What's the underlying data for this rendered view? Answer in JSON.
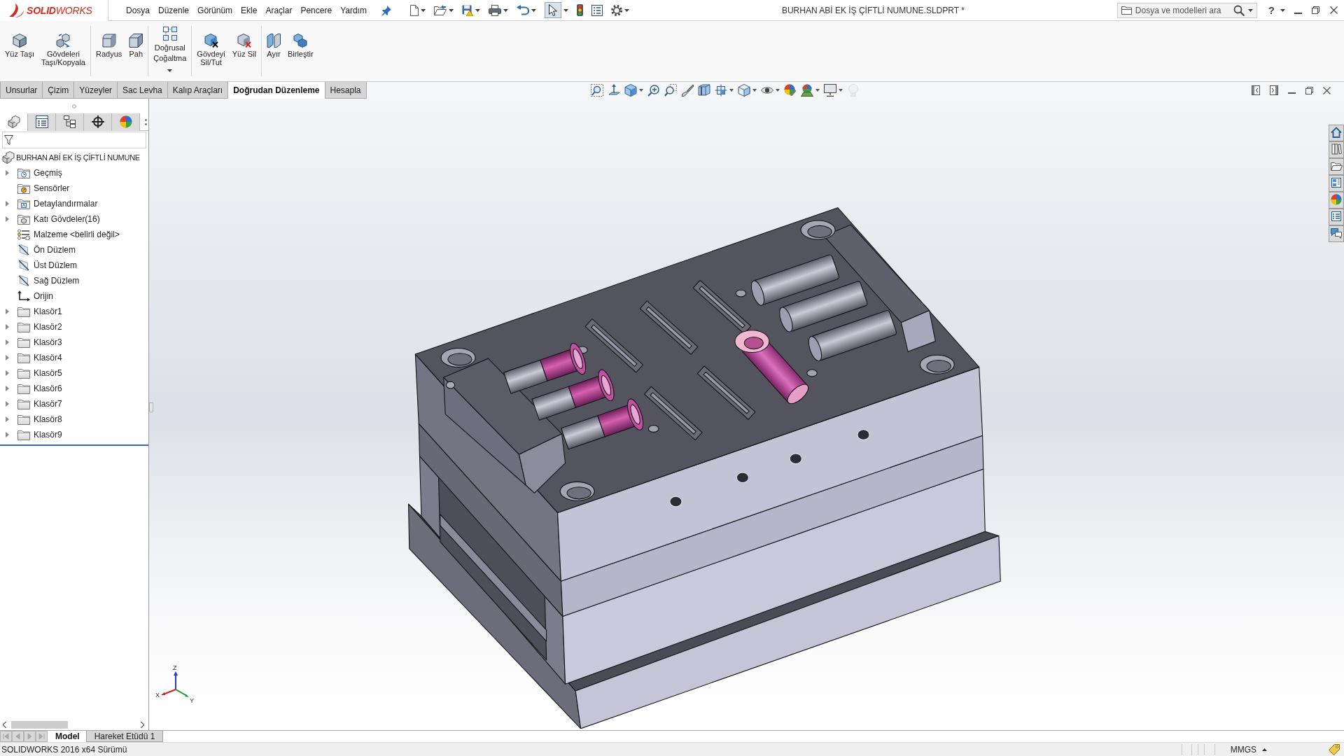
{
  "title_bar": {
    "logo": "**SOLID**WORKS",
    "menu": [
      "Dosya",
      "Düzenle",
      "Görünüm",
      "Ekle",
      "Araçlar",
      "Pencere",
      "Yardım"
    ],
    "toolbar": [
      {
        "dropdown": true,
        "active": false
      },
      {
        "dropdown": true,
        "active": false
      },
      {
        "dropdown": true,
        "active": false
      },
      {
        "dropdown": true,
        "active": false
      },
      {
        "dropdown": true,
        "active": false
      },
      {
        "dropdown": true,
        "active": true
      },
      {
        "dropdown": false,
        "active": false
      },
      {
        "dropdown": false,
        "active": false
      },
      {
        "dropdown": true,
        "active": false
      }
    ],
    "document_title": "BURHAN ABİ EK İŞ ÇİFTLİ NUMUNE.SLDPRT *",
    "search": {
      "placeholder": "Dosya ve modelleri ara"
    },
    "help": {
      "label": "?",
      "dropdown": true
    }
  },
  "ribbon": {
    "groups": [
      [
        {
          "label": "Yüz Taşı",
          "dropdown": false
        },
        {
          "label": "Gövdeleri\nTaşı/Kopyala",
          "dropdown": false
        }
      ],
      [
        {
          "label": "Radyus",
          "dropdown": false
        },
        {
          "label": "Pah",
          "dropdown": false
        }
      ],
      [
        {
          "label": "Doğrusal\nÇoğaltma",
          "dropdown": true
        }
      ],
      [
        {
          "label": "Gövdeyi\nSil/Tut",
          "dropdown": false
        },
        {
          "label": "Yüz Sil",
          "dropdown": false
        }
      ],
      [
        {
          "label": "Ayır",
          "dropdown": false
        },
        {
          "label": "Birleştir",
          "dropdown": false
        }
      ]
    ],
    "tabs": [
      {
        "label": "Unsurlar",
        "selected": false
      },
      {
        "label": "Çizim",
        "selected": false
      },
      {
        "label": "Yüzeyler",
        "selected": false
      },
      {
        "label": "Sac Levha",
        "selected": false
      },
      {
        "label": "Kalıp Araçları",
        "selected": false
      },
      {
        "label": "Doğrudan Düzenleme",
        "selected": true
      },
      {
        "label": "Hesapla",
        "selected": false
      }
    ]
  },
  "view_toolbar": [
    {
      "dropdown": false,
      "disabled": false
    },
    {
      "dropdown": false,
      "disabled": false
    },
    {
      "dropdown": true,
      "disabled": false
    },
    {
      "dropdown": false,
      "disabled": false
    },
    {
      "dropdown": false,
      "disabled": false
    },
    {
      "dropdown": false,
      "disabled": false
    },
    {
      "dropdown": false,
      "disabled": false
    },
    {
      "dropdown": true,
      "disabled": false
    },
    {
      "dropdown": true,
      "disabled": false
    },
    {
      "dropdown": true,
      "disabled": false
    },
    {
      "dropdown": false,
      "disabled": false
    },
    {
      "dropdown": true,
      "disabled": false
    },
    {
      "dropdown": true,
      "disabled": false
    },
    {
      "dropdown": false,
      "disabled": true
    }
  ],
  "feature_manager": {
    "tabs": [
      {
        "selected": true
      },
      {
        "selected": false
      },
      {
        "selected": false
      },
      {
        "selected": false
      },
      {
        "selected": false
      }
    ],
    "root": "BURHAN ABİ EK İŞ ÇİFTLİ NUMUNE",
    "items": [
      {
        "label": "Geçmiş",
        "kind": "history",
        "expanded": false
      },
      {
        "label": "Sensörler",
        "kind": "sensors"
      },
      {
        "label": "Detaylandırmalar",
        "kind": "annotations",
        "expanded": false
      },
      {
        "label": "Katı Gövdeler(16)",
        "kind": "bodies",
        "expanded": false
      },
      {
        "label": "Malzeme <belirli değil>",
        "kind": "material"
      },
      {
        "label": "Ön Düzlem",
        "kind": "plane"
      },
      {
        "label": "Üst Düzlem",
        "kind": "plane"
      },
      {
        "label": "Sağ Düzlem",
        "kind": "plane"
      },
      {
        "label": "Orijin",
        "kind": "origin"
      },
      {
        "label": "Klasör1",
        "kind": "folder",
        "expanded": false
      },
      {
        "label": "Klasör2",
        "kind": "folder",
        "expanded": false
      },
      {
        "label": "Klasör3",
        "kind": "folder",
        "expanded": false
      },
      {
        "label": "Klasör4",
        "kind": "folder",
        "expanded": false
      },
      {
        "label": "Klasör5",
        "kind": "folder",
        "expanded": false
      },
      {
        "label": "Klasör6",
        "kind": "folder",
        "expanded": false
      },
      {
        "label": "Klasör7",
        "kind": "folder",
        "expanded": false
      },
      {
        "label": "Klasör8",
        "kind": "folder",
        "expanded": false
      },
      {
        "label": "Klasör9",
        "kind": "folder",
        "expanded": false
      }
    ]
  },
  "triad": {
    "labels": [
      "X",
      "Y",
      "Z"
    ]
  },
  "bottom_tabs": {
    "scroll_buttons": [
      {
        "disabled": true
      },
      {
        "disabled": true
      },
      {
        "disabled": true
      },
      {
        "disabled": true
      }
    ],
    "tabs": [
      {
        "label": "Model",
        "selected": true
      },
      {
        "label": "Hareket Etüdü 1",
        "selected": false
      }
    ]
  },
  "status_bar": {
    "text": "SOLIDWORKS 2016 x64 Sürümü",
    "units": "MMGS"
  }
}
